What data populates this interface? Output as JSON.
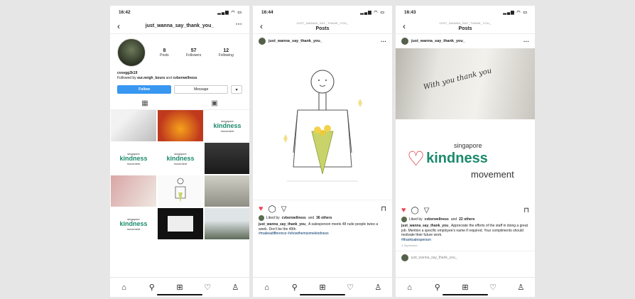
{
  "phone1": {
    "time": "16:42",
    "username": "just_wanna_say_thank_you_",
    "stats": [
      {
        "n": "8",
        "l": "Posts"
      },
      {
        "n": "57",
        "l": "Followers"
      },
      {
        "n": "12",
        "l": "Following"
      }
    ],
    "bio_name": "cvsegg2k19",
    "followed_by_prefix": "Followed by",
    "followed_by_a": "our.neigh_bours",
    "followed_by_and": "and",
    "followed_by_b": "cvberwellness",
    "follow_label": "Follow",
    "message_label": "Message",
    "logo_small": {
      "top": "singapore",
      "main": "kindness",
      "bottom": "movement"
    }
  },
  "phone2": {
    "time": "16:44",
    "header_sub": "JUST_WANNA_SAY_THANK_YOU_",
    "header_title": "Posts",
    "username": "just_wanna_say_thank_you_",
    "liked_by": "Liked by",
    "liked_user": "cvberwellness",
    "liked_and": "and",
    "liked_others": "36 others",
    "caption_user": "just_wanna_say_thank_you_",
    "caption_text": "A salesperson meets 48 rude people twice a week. Don't be the 49th.",
    "tags": "#makeadifference #showthemsomekindness"
  },
  "phone3": {
    "time": "16:43",
    "header_sub": "JUST_WANNA_SAY_THANK_YOU_",
    "header_title": "Posts",
    "username": "just_wanna_say_thank_you_",
    "photo_handwriting": "With you thank you",
    "logo": {
      "top": "singapore",
      "main": "kindness",
      "bottom": "movement"
    },
    "liked_by": "Liked by",
    "liked_user": "cvberwellness",
    "liked_and": "and",
    "liked_others": "22 others",
    "caption_user": "just_wanna_say_thank_you_",
    "caption_text": "Appreciate the efforts of the staff in doing a great job. Mention a specific employee's name if required. Your compliments should motivate their future work.",
    "tags": "#thanksalesperson",
    "date": "4 September",
    "next_user": "just_wanna_say_thank_you_"
  }
}
